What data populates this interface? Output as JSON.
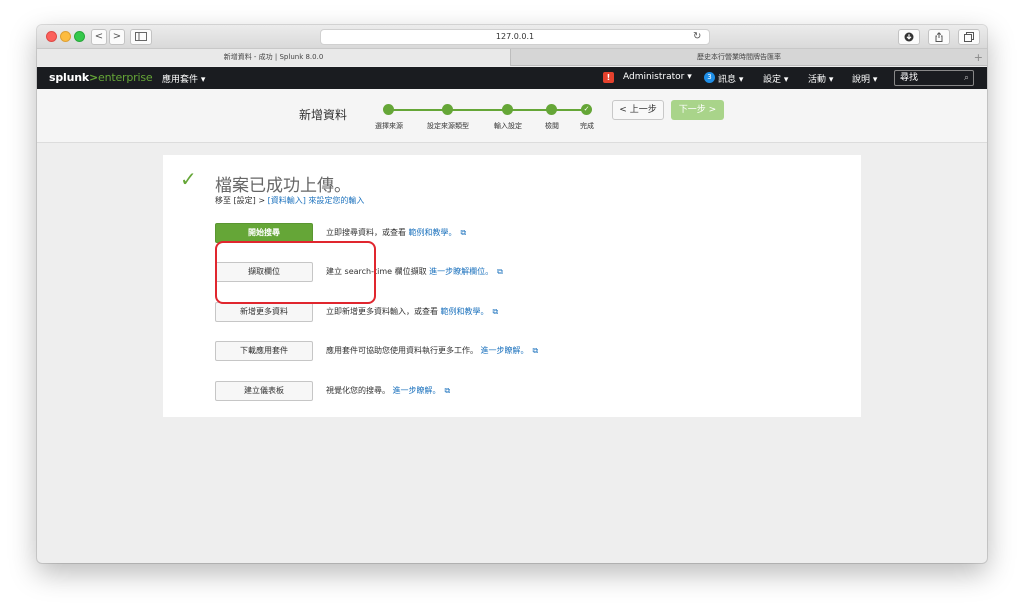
{
  "browser": {
    "url": "127.0.0.1",
    "tabs": [
      {
        "label": "新增資料 - 成功 | Splunk 8.0.0"
      },
      {
        "label": "歷史本行營業時間牌告匯率"
      }
    ],
    "back": "<",
    "forward": ">",
    "plus": "+"
  },
  "nav": {
    "logo": {
      "splunk": "splunk",
      "gt": ">",
      "ent": "enterprise"
    },
    "apps": "應用套件 ▾",
    "admin": "Administrator ▾",
    "warn_badge": "!",
    "msg_count": "3",
    "messages": "訊息 ▾",
    "settings": "設定 ▾",
    "activity": "活動 ▾",
    "help": "說明 ▾",
    "search_placeholder": "尋找"
  },
  "wizard": {
    "title": "新增資料",
    "steps": [
      {
        "label": "選擇來源"
      },
      {
        "label": "設定來源類型"
      },
      {
        "label": "輸入設定"
      },
      {
        "label": "檢閱"
      },
      {
        "label": "完成"
      }
    ],
    "prev": "< 上一步",
    "next": "下一步 >"
  },
  "success": {
    "title": "檔案已成功上傳。",
    "sub_prefix": "移至 [設定] > ",
    "sub_link": "[資料輸入]",
    "sub_suffix": " 來設定您的輸入"
  },
  "actions": [
    {
      "label": "開始搜尋",
      "desc": "立即搜尋資料，或查看 ",
      "link": "範例和教學。"
    },
    {
      "label": "擷取欄位",
      "desc": "建立 search-time 欄位擷取 ",
      "link": "進一步瞭解欄位。"
    },
    {
      "label": "新增更多資料",
      "desc": "立即新增更多資料輸入，或查看 ",
      "link": "範例和教學。"
    },
    {
      "label": "下載應用套件",
      "desc": "應用套件可協助您使用資料執行更多工作。 ",
      "link": "進一步瞭解。"
    },
    {
      "label": "建立儀表板",
      "desc": "視覺化您的搜尋。 ",
      "link": "進一步瞭解。"
    }
  ]
}
